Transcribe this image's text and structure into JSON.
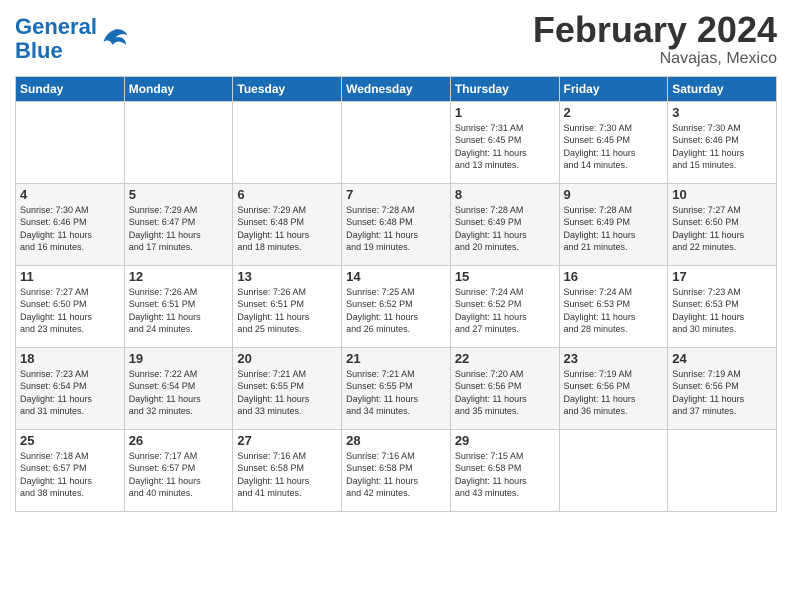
{
  "header": {
    "title": "February 2024",
    "subtitle": "Navajas, Mexico",
    "logo_line1": "General",
    "logo_line2": "Blue"
  },
  "days_of_week": [
    "Sunday",
    "Monday",
    "Tuesday",
    "Wednesday",
    "Thursday",
    "Friday",
    "Saturday"
  ],
  "weeks": [
    [
      {
        "day": "",
        "info": ""
      },
      {
        "day": "",
        "info": ""
      },
      {
        "day": "",
        "info": ""
      },
      {
        "day": "",
        "info": ""
      },
      {
        "day": "1",
        "info": "Sunrise: 7:31 AM\nSunset: 6:45 PM\nDaylight: 11 hours\nand 13 minutes."
      },
      {
        "day": "2",
        "info": "Sunrise: 7:30 AM\nSunset: 6:45 PM\nDaylight: 11 hours\nand 14 minutes."
      },
      {
        "day": "3",
        "info": "Sunrise: 7:30 AM\nSunset: 6:46 PM\nDaylight: 11 hours\nand 15 minutes."
      }
    ],
    [
      {
        "day": "4",
        "info": "Sunrise: 7:30 AM\nSunset: 6:46 PM\nDaylight: 11 hours\nand 16 minutes."
      },
      {
        "day": "5",
        "info": "Sunrise: 7:29 AM\nSunset: 6:47 PM\nDaylight: 11 hours\nand 17 minutes."
      },
      {
        "day": "6",
        "info": "Sunrise: 7:29 AM\nSunset: 6:48 PM\nDaylight: 11 hours\nand 18 minutes."
      },
      {
        "day": "7",
        "info": "Sunrise: 7:28 AM\nSunset: 6:48 PM\nDaylight: 11 hours\nand 19 minutes."
      },
      {
        "day": "8",
        "info": "Sunrise: 7:28 AM\nSunset: 6:49 PM\nDaylight: 11 hours\nand 20 minutes."
      },
      {
        "day": "9",
        "info": "Sunrise: 7:28 AM\nSunset: 6:49 PM\nDaylight: 11 hours\nand 21 minutes."
      },
      {
        "day": "10",
        "info": "Sunrise: 7:27 AM\nSunset: 6:50 PM\nDaylight: 11 hours\nand 22 minutes."
      }
    ],
    [
      {
        "day": "11",
        "info": "Sunrise: 7:27 AM\nSunset: 6:50 PM\nDaylight: 11 hours\nand 23 minutes."
      },
      {
        "day": "12",
        "info": "Sunrise: 7:26 AM\nSunset: 6:51 PM\nDaylight: 11 hours\nand 24 minutes."
      },
      {
        "day": "13",
        "info": "Sunrise: 7:26 AM\nSunset: 6:51 PM\nDaylight: 11 hours\nand 25 minutes."
      },
      {
        "day": "14",
        "info": "Sunrise: 7:25 AM\nSunset: 6:52 PM\nDaylight: 11 hours\nand 26 minutes."
      },
      {
        "day": "15",
        "info": "Sunrise: 7:24 AM\nSunset: 6:52 PM\nDaylight: 11 hours\nand 27 minutes."
      },
      {
        "day": "16",
        "info": "Sunrise: 7:24 AM\nSunset: 6:53 PM\nDaylight: 11 hours\nand 28 minutes."
      },
      {
        "day": "17",
        "info": "Sunrise: 7:23 AM\nSunset: 6:53 PM\nDaylight: 11 hours\nand 30 minutes."
      }
    ],
    [
      {
        "day": "18",
        "info": "Sunrise: 7:23 AM\nSunset: 6:54 PM\nDaylight: 11 hours\nand 31 minutes."
      },
      {
        "day": "19",
        "info": "Sunrise: 7:22 AM\nSunset: 6:54 PM\nDaylight: 11 hours\nand 32 minutes."
      },
      {
        "day": "20",
        "info": "Sunrise: 7:21 AM\nSunset: 6:55 PM\nDaylight: 11 hours\nand 33 minutes."
      },
      {
        "day": "21",
        "info": "Sunrise: 7:21 AM\nSunset: 6:55 PM\nDaylight: 11 hours\nand 34 minutes."
      },
      {
        "day": "22",
        "info": "Sunrise: 7:20 AM\nSunset: 6:56 PM\nDaylight: 11 hours\nand 35 minutes."
      },
      {
        "day": "23",
        "info": "Sunrise: 7:19 AM\nSunset: 6:56 PM\nDaylight: 11 hours\nand 36 minutes."
      },
      {
        "day": "24",
        "info": "Sunrise: 7:19 AM\nSunset: 6:56 PM\nDaylight: 11 hours\nand 37 minutes."
      }
    ],
    [
      {
        "day": "25",
        "info": "Sunrise: 7:18 AM\nSunset: 6:57 PM\nDaylight: 11 hours\nand 38 minutes."
      },
      {
        "day": "26",
        "info": "Sunrise: 7:17 AM\nSunset: 6:57 PM\nDaylight: 11 hours\nand 40 minutes."
      },
      {
        "day": "27",
        "info": "Sunrise: 7:16 AM\nSunset: 6:58 PM\nDaylight: 11 hours\nand 41 minutes."
      },
      {
        "day": "28",
        "info": "Sunrise: 7:16 AM\nSunset: 6:58 PM\nDaylight: 11 hours\nand 42 minutes."
      },
      {
        "day": "29",
        "info": "Sunrise: 7:15 AM\nSunset: 6:58 PM\nDaylight: 11 hours\nand 43 minutes."
      },
      {
        "day": "",
        "info": ""
      },
      {
        "day": "",
        "info": ""
      }
    ]
  ]
}
